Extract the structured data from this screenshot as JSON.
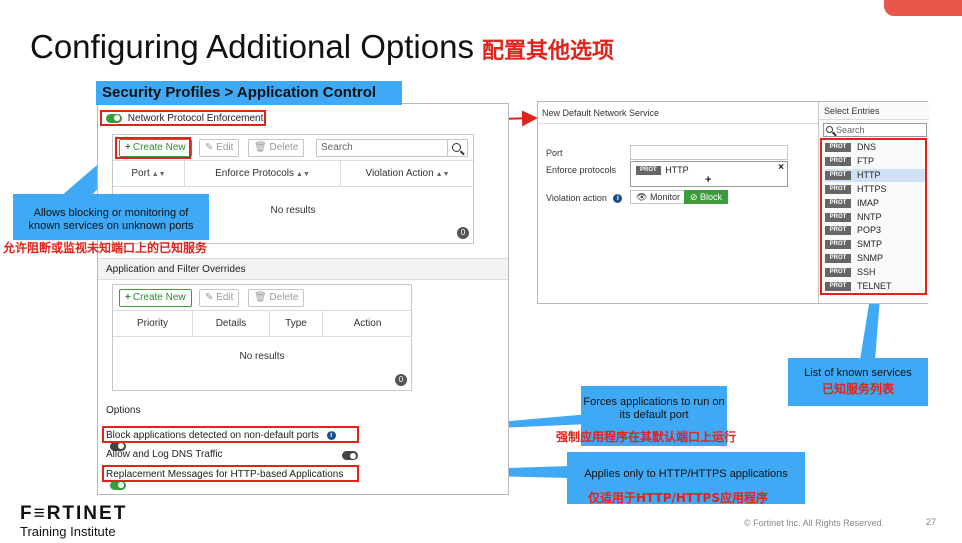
{
  "slide": {
    "title_en": "Configuring Additional Options",
    "title_cn": "配置其他选项",
    "page_number": "27",
    "copyright": "© Fortinet Inc. All Rights Reserved.",
    "logo_text": "F≡RTINET",
    "logo_sub": "Training Institute"
  },
  "colors": {
    "accent_red": "#e0241b",
    "callout_blue": "#3fa9f5",
    "toggle_green": "#3c9b3c"
  },
  "left_panel": {
    "header": "Security Profiles > Application Control",
    "npe_label": "Network Protocol Enforcement",
    "npe_enabled": true,
    "toolbar": {
      "create_new": "Create New",
      "edit": "Edit",
      "delete": "Delete",
      "search_placeholder": "Search"
    },
    "npe_columns": [
      "Port",
      "Enforce Protocols",
      "Violation Action"
    ],
    "npe_no_results": "No results",
    "npe_count": "0",
    "overrides_section": "Application and Filter Overrides",
    "overrides_toolbar": {
      "create_new": "Create New",
      "edit": "Edit",
      "delete": "Delete"
    },
    "overrides_columns": [
      "Priority",
      "Details",
      "Type",
      "Action"
    ],
    "overrides_no_results": "No results",
    "overrides_count": "0",
    "options_section": "Options",
    "options": [
      {
        "label": "Block applications detected on non-default ports",
        "enabled": false
      },
      {
        "label": "Allow and Log DNS Traffic",
        "enabled": false
      },
      {
        "label": "Replacement Messages for HTTP-based Applications",
        "enabled": true
      }
    ]
  },
  "right_panel": {
    "title": "New Default Network Service",
    "port_label": "Port",
    "enforce_label": "Enforce protocols",
    "enforce_value": "HTTP",
    "violation_label": "Violation action",
    "monitor_label": "Monitor",
    "block_label": "Block",
    "select_entries": "Select Entries",
    "search_placeholder": "Search",
    "prot_tag": "PROT",
    "services": [
      "DNS",
      "FTP",
      "HTTP",
      "HTTPS",
      "IMAP",
      "NNTP",
      "POP3",
      "SMTP",
      "SNMP",
      "SSH",
      "TELNET"
    ]
  },
  "callouts": {
    "npe_en": "Allows blocking or monitoring of known services on unknown ports",
    "npe_cn": "允许阻断或监视未知端口上的已知服务",
    "services_en": "List of known services",
    "services_cn": "已知服务列表",
    "default_port_en": "Forces applications to run on its default port",
    "default_port_cn": "强制应用程序在其默认端口上运行",
    "http_en": "Applies only to HTTP/HTTPS applications",
    "http_cn": "仅适用于HTTP/HTTPS应用程序"
  }
}
